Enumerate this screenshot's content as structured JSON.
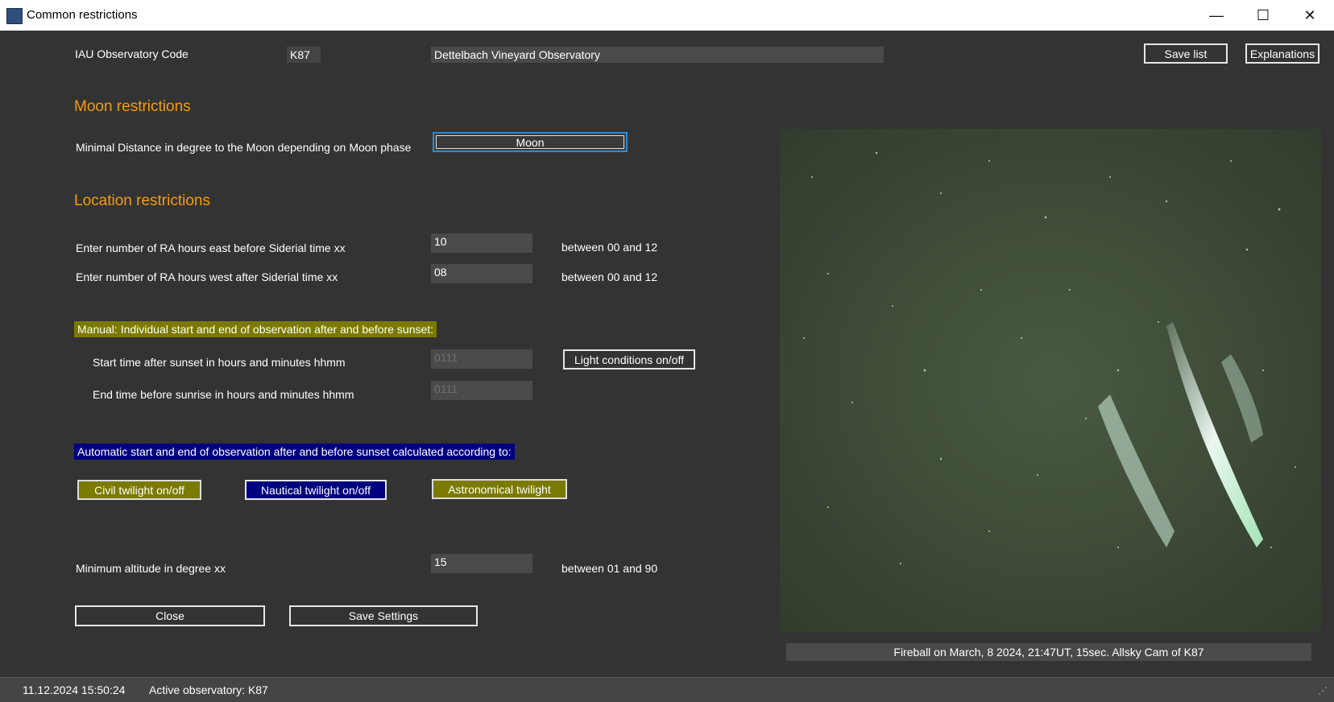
{
  "window": {
    "title": "Common restrictions"
  },
  "header": {
    "iau_label": "IAU Observatory Code",
    "iau_code": "K87",
    "observatory_name": "Dettelbach Vineyard Observatory",
    "save_list_label": "Save list",
    "explanations_label": "Explanations"
  },
  "moon": {
    "heading": "Moon restrictions",
    "distance_label": "Minimal Distance in degree to the Moon depending on Moon phase",
    "moon_button_label": "Moon"
  },
  "location": {
    "heading": "Location restrictions",
    "east_label": "Enter number of RA hours east before Siderial time xx",
    "east_value": "10",
    "east_range": "between 00 and 12",
    "west_label": "Enter number of RA hours west after Siderial time xx",
    "west_value": "08",
    "west_range": "between 00 and 12"
  },
  "manual": {
    "heading": "Manual: Individual start and end of observation after and before sunset:",
    "start_label": "Start time after sunset in hours and minutes   hhmm",
    "start_value": "0111",
    "end_label": "End time before sunrise in hours and minutes   hhmm",
    "end_value": "0111",
    "light_button_label": "Light conditions on/off"
  },
  "automatic": {
    "heading": "Automatic start and end of observation after and before sunset calculated according to:",
    "civil_label": "Civil twilight on/off",
    "nautical_label": "Nautical twilight on/off",
    "astronomical_label": "Astronomical twilight"
  },
  "altitude": {
    "label": "Minimum altitude in degree  xx",
    "value": "15",
    "range": "between 01 and 90"
  },
  "actions": {
    "close_label": "Close",
    "save_settings_label": "Save Settings"
  },
  "photo": {
    "caption": "Fireball on March, 8 2024, 21:47UT, 15sec. Allsky Cam of K87"
  },
  "status": {
    "timestamp": "11.12.2024 15:50:24",
    "active_observatory": "Active observatory: K87"
  },
  "colors": {
    "background": "#333333",
    "accent_heading": "#f39c12",
    "olive": "#7a7a00",
    "navy": "#00007f"
  }
}
